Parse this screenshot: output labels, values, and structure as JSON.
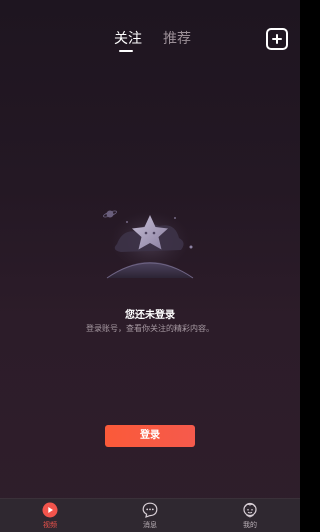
{
  "header": {
    "tabs": [
      {
        "label": "关注",
        "active": true
      },
      {
        "label": "推荐",
        "active": false
      }
    ],
    "add_icon": "plus-square-icon"
  },
  "empty_state": {
    "illustration": "planet-star-icon",
    "title": "您还未登录",
    "description": "登录账号，查看你关注的精彩内容。"
  },
  "login_button": {
    "label": "登录",
    "color": "#f85a40"
  },
  "bottom_nav": {
    "items": [
      {
        "label": "视频",
        "icon": "play-circle-icon",
        "active": true
      },
      {
        "label": "消息",
        "icon": "chat-bubble-icon",
        "active": false
      },
      {
        "label": "我的",
        "icon": "user-face-icon",
        "active": false
      }
    ],
    "active_color": "#f2544c"
  }
}
